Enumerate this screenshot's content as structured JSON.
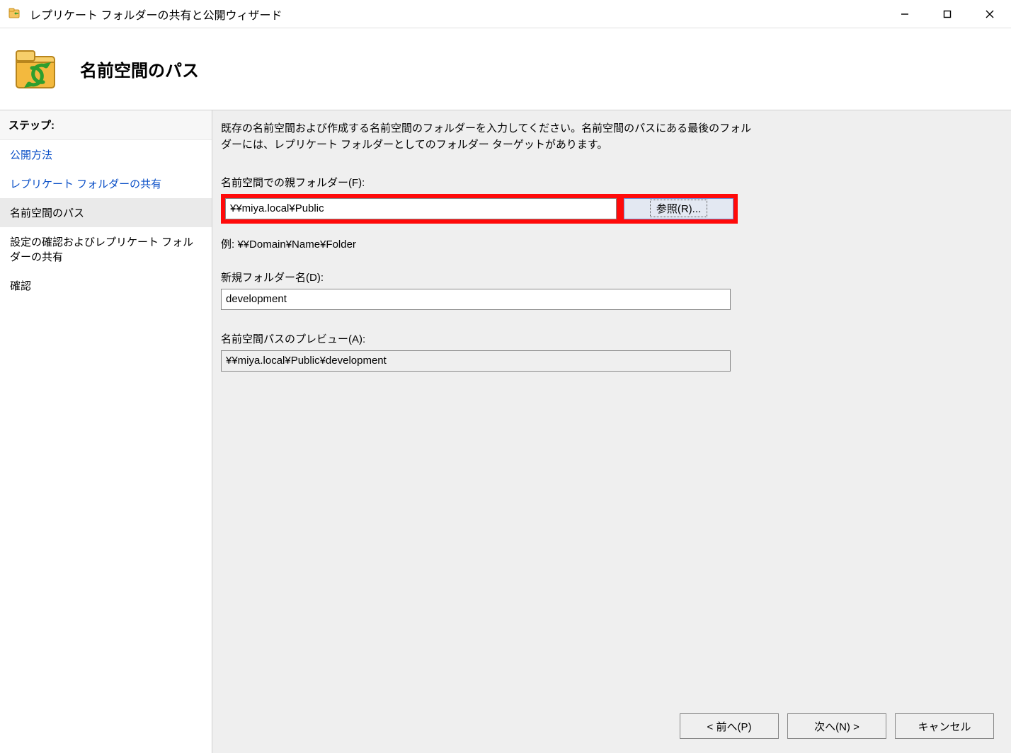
{
  "window": {
    "title": "レプリケート フォルダーの共有と公開ウィザード"
  },
  "header": {
    "title": "名前空間のパス"
  },
  "sidebar": {
    "heading": "ステップ:",
    "items": [
      {
        "label": "公開方法",
        "state": "link"
      },
      {
        "label": "レプリケート フォルダーの共有",
        "state": "link"
      },
      {
        "label": "名前空間のパス",
        "state": "active"
      },
      {
        "label": "設定の確認およびレプリケート フォルダーの共有",
        "state": "disabled"
      },
      {
        "label": "確認",
        "state": "disabled"
      }
    ]
  },
  "content": {
    "instruction": "既存の名前空間および作成する名前空間のフォルダーを入力してください。名前空間のパスにある最後のフォルダーには、レプリケート フォルダーとしてのフォルダー ターゲットがあります。",
    "parent_label": "名前空間での親フォルダー(F):",
    "parent_value": "¥¥miya.local¥Public",
    "browse_label": "参照(R)...",
    "example": "例: ¥¥Domain¥Name¥Folder",
    "newname_label": "新規フォルダー名(D):",
    "newname_value": "development",
    "preview_label": "名前空間パスのプレビュー(A):",
    "preview_value": "¥¥miya.local¥Public¥development"
  },
  "footer": {
    "prev": "< 前へ(P)",
    "next": "次へ(N) >",
    "cancel": "キャンセル"
  }
}
